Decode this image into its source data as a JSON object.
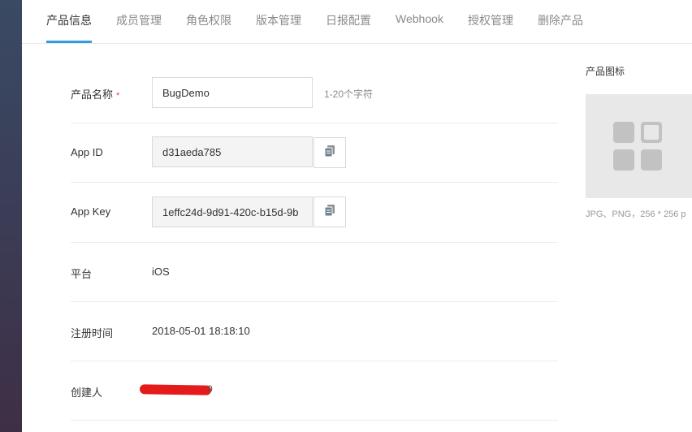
{
  "tabs": [
    {
      "label": "产品信息",
      "active": true
    },
    {
      "label": "成员管理"
    },
    {
      "label": "角色权限"
    },
    {
      "label": "版本管理"
    },
    {
      "label": "日报配置"
    },
    {
      "label": "Webhook"
    },
    {
      "label": "授权管理"
    },
    {
      "label": "删除产品"
    }
  ],
  "form": {
    "product_name": {
      "label": "产品名称",
      "required_mark": "*",
      "value": "BugDemo",
      "hint": "1-20个字符"
    },
    "app_id": {
      "label": "App ID",
      "value": "d31aeda785"
    },
    "app_key": {
      "label": "App Key",
      "value": "1effc24d-9d91-420c-b15d-9b"
    },
    "platform": {
      "label": "平台",
      "value": "iOS"
    },
    "register_time": {
      "label": "注册时间",
      "value": "2018-05-01 18:18:10"
    },
    "creator": {
      "label": "创建人",
      "value_suffix": "0"
    }
  },
  "product_icon": {
    "title": "产品图标",
    "hint": "JPG、PNG，256 * 256 p",
    "icon": "app-grid-placeholder-icon"
  },
  "icons": {
    "copy": "copy-icon"
  },
  "colors": {
    "accent": "#2d9ee0",
    "required": "#e64545",
    "redaction": "#e51b1b"
  }
}
